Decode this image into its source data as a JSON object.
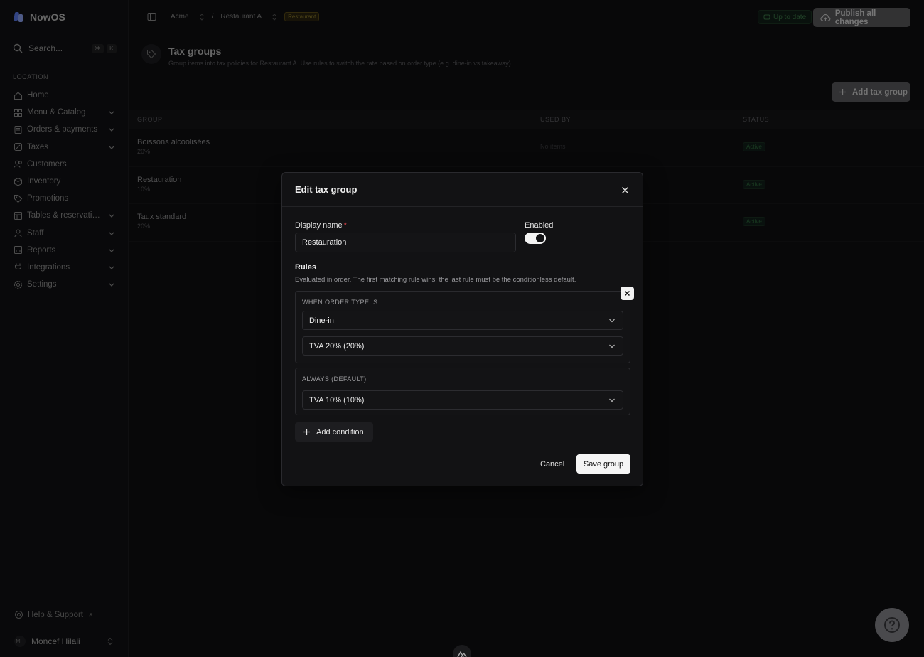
{
  "app": {
    "name": "NowOS",
    "brand_color": "#5b7cf0"
  },
  "search": {
    "placeholder": "Search...",
    "kbd": [
      "⌘",
      "K"
    ]
  },
  "sidebar": {
    "section_label": "LOCATION",
    "items": [
      {
        "label": "Home",
        "icon": "home-icon",
        "expandable": false
      },
      {
        "label": "Menu & Catalog",
        "icon": "grid-icon",
        "expandable": true
      },
      {
        "label": "Orders & payments",
        "icon": "receipt-icon",
        "expandable": true
      },
      {
        "label": "Taxes",
        "icon": "percent-icon",
        "expandable": true
      },
      {
        "label": "Customers",
        "icon": "users-icon",
        "expandable": false
      },
      {
        "label": "Inventory",
        "icon": "box-icon",
        "expandable": false
      },
      {
        "label": "Promotions",
        "icon": "tag-icon",
        "expandable": false
      },
      {
        "label": "Tables & reservations",
        "icon": "table-icon",
        "expandable": true
      },
      {
        "label": "Staff",
        "icon": "user-icon",
        "expandable": true
      },
      {
        "label": "Reports",
        "icon": "chart-icon",
        "expandable": true
      },
      {
        "label": "Integrations",
        "icon": "plug-icon",
        "expandable": true
      },
      {
        "label": "Settings",
        "icon": "gear-icon",
        "expandable": true
      }
    ],
    "help_label": "Help & Support",
    "user": {
      "initials": "MH",
      "name": "Moncef Hilali"
    }
  },
  "topbar": {
    "breadcrumb": {
      "org": "Acme",
      "location": "Restaurant A",
      "badge": "Restaurant",
      "separator": "/"
    },
    "status": "Up to date",
    "publish_label": "Publish all changes"
  },
  "page": {
    "title": "Tax groups",
    "subtitle": "Group items into tax policies for Restaurant A. Use rules to switch the rate based on order type (e.g. dine-in vs takeaway).",
    "add_label": "Add tax group"
  },
  "table": {
    "headers": {
      "group": "GROUP",
      "used_by": "USED BY",
      "status": "STATUS"
    },
    "rows": [
      {
        "name": "Boissons alcoolisées",
        "rate": "20%",
        "used_by": "No items",
        "status": "Active"
      },
      {
        "name": "Restauration",
        "rate": "10%",
        "used_by": "",
        "status": "Active"
      },
      {
        "name": "Taux standard",
        "rate": "20%",
        "used_by": "",
        "status": "Active"
      }
    ]
  },
  "modal": {
    "title": "Edit tax group",
    "display_name_label": "Display name",
    "required_mark": "*",
    "display_name_value": "Restauration",
    "enabled_label": "Enabled",
    "enabled": true,
    "rules_title": "Rules",
    "rules_subtitle": "Evaluated in order. The first matching rule wins; the last rule must be the conditionless default.",
    "rules": [
      {
        "label": "WHEN ORDER TYPE IS",
        "condition_value": "Dine-in",
        "tax_value": "TVA 20% (20%)"
      }
    ],
    "default_rule": {
      "label": "ALWAYS (DEFAULT)",
      "tax_value": "TVA 10% (10%)"
    },
    "add_condition_label": "Add condition",
    "cancel_label": "Cancel",
    "save_label": "Save group"
  }
}
